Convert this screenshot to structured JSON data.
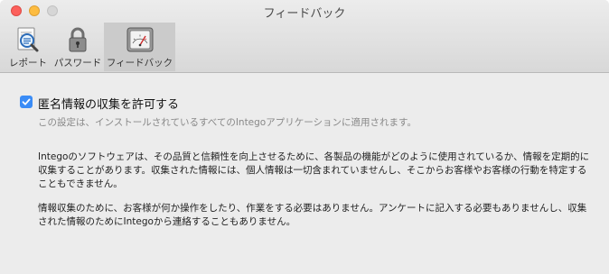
{
  "window": {
    "title": "フィードバック"
  },
  "toolbar": {
    "tabs": [
      {
        "label": "レポート",
        "icon": "report-magnifier-icon"
      },
      {
        "label": "パスワード",
        "icon": "padlock-icon"
      },
      {
        "label": "フィードバック",
        "icon": "gauge-meter-icon",
        "selected": true
      }
    ]
  },
  "main": {
    "checkbox_label": "匿名情報の収集を許可する",
    "checkbox_checked": true,
    "description": "この設定は、インストールされているすべてのIntegoアプリケーションに適用されます。",
    "paragraph1": "Integoのソフトウェアは、その品質と信頼性を向上させるために、各製品の機能がどのように使用されているか、情報を定期的に収集することがあります。収集された情報には、個人情報は一切含まれていませんし、そこからお客様やお客様の行動を特定することもできません。",
    "paragraph2": "情報収集のために、お客様が何か操作をしたり、作業をする必要はありません。アンケートに記入する必要もありませんし、収集された情報のためにIntegoから連絡することもありません。"
  },
  "colors": {
    "accent": "#3a8cf6",
    "close": "#fc605c",
    "minimize": "#fdbc40"
  }
}
